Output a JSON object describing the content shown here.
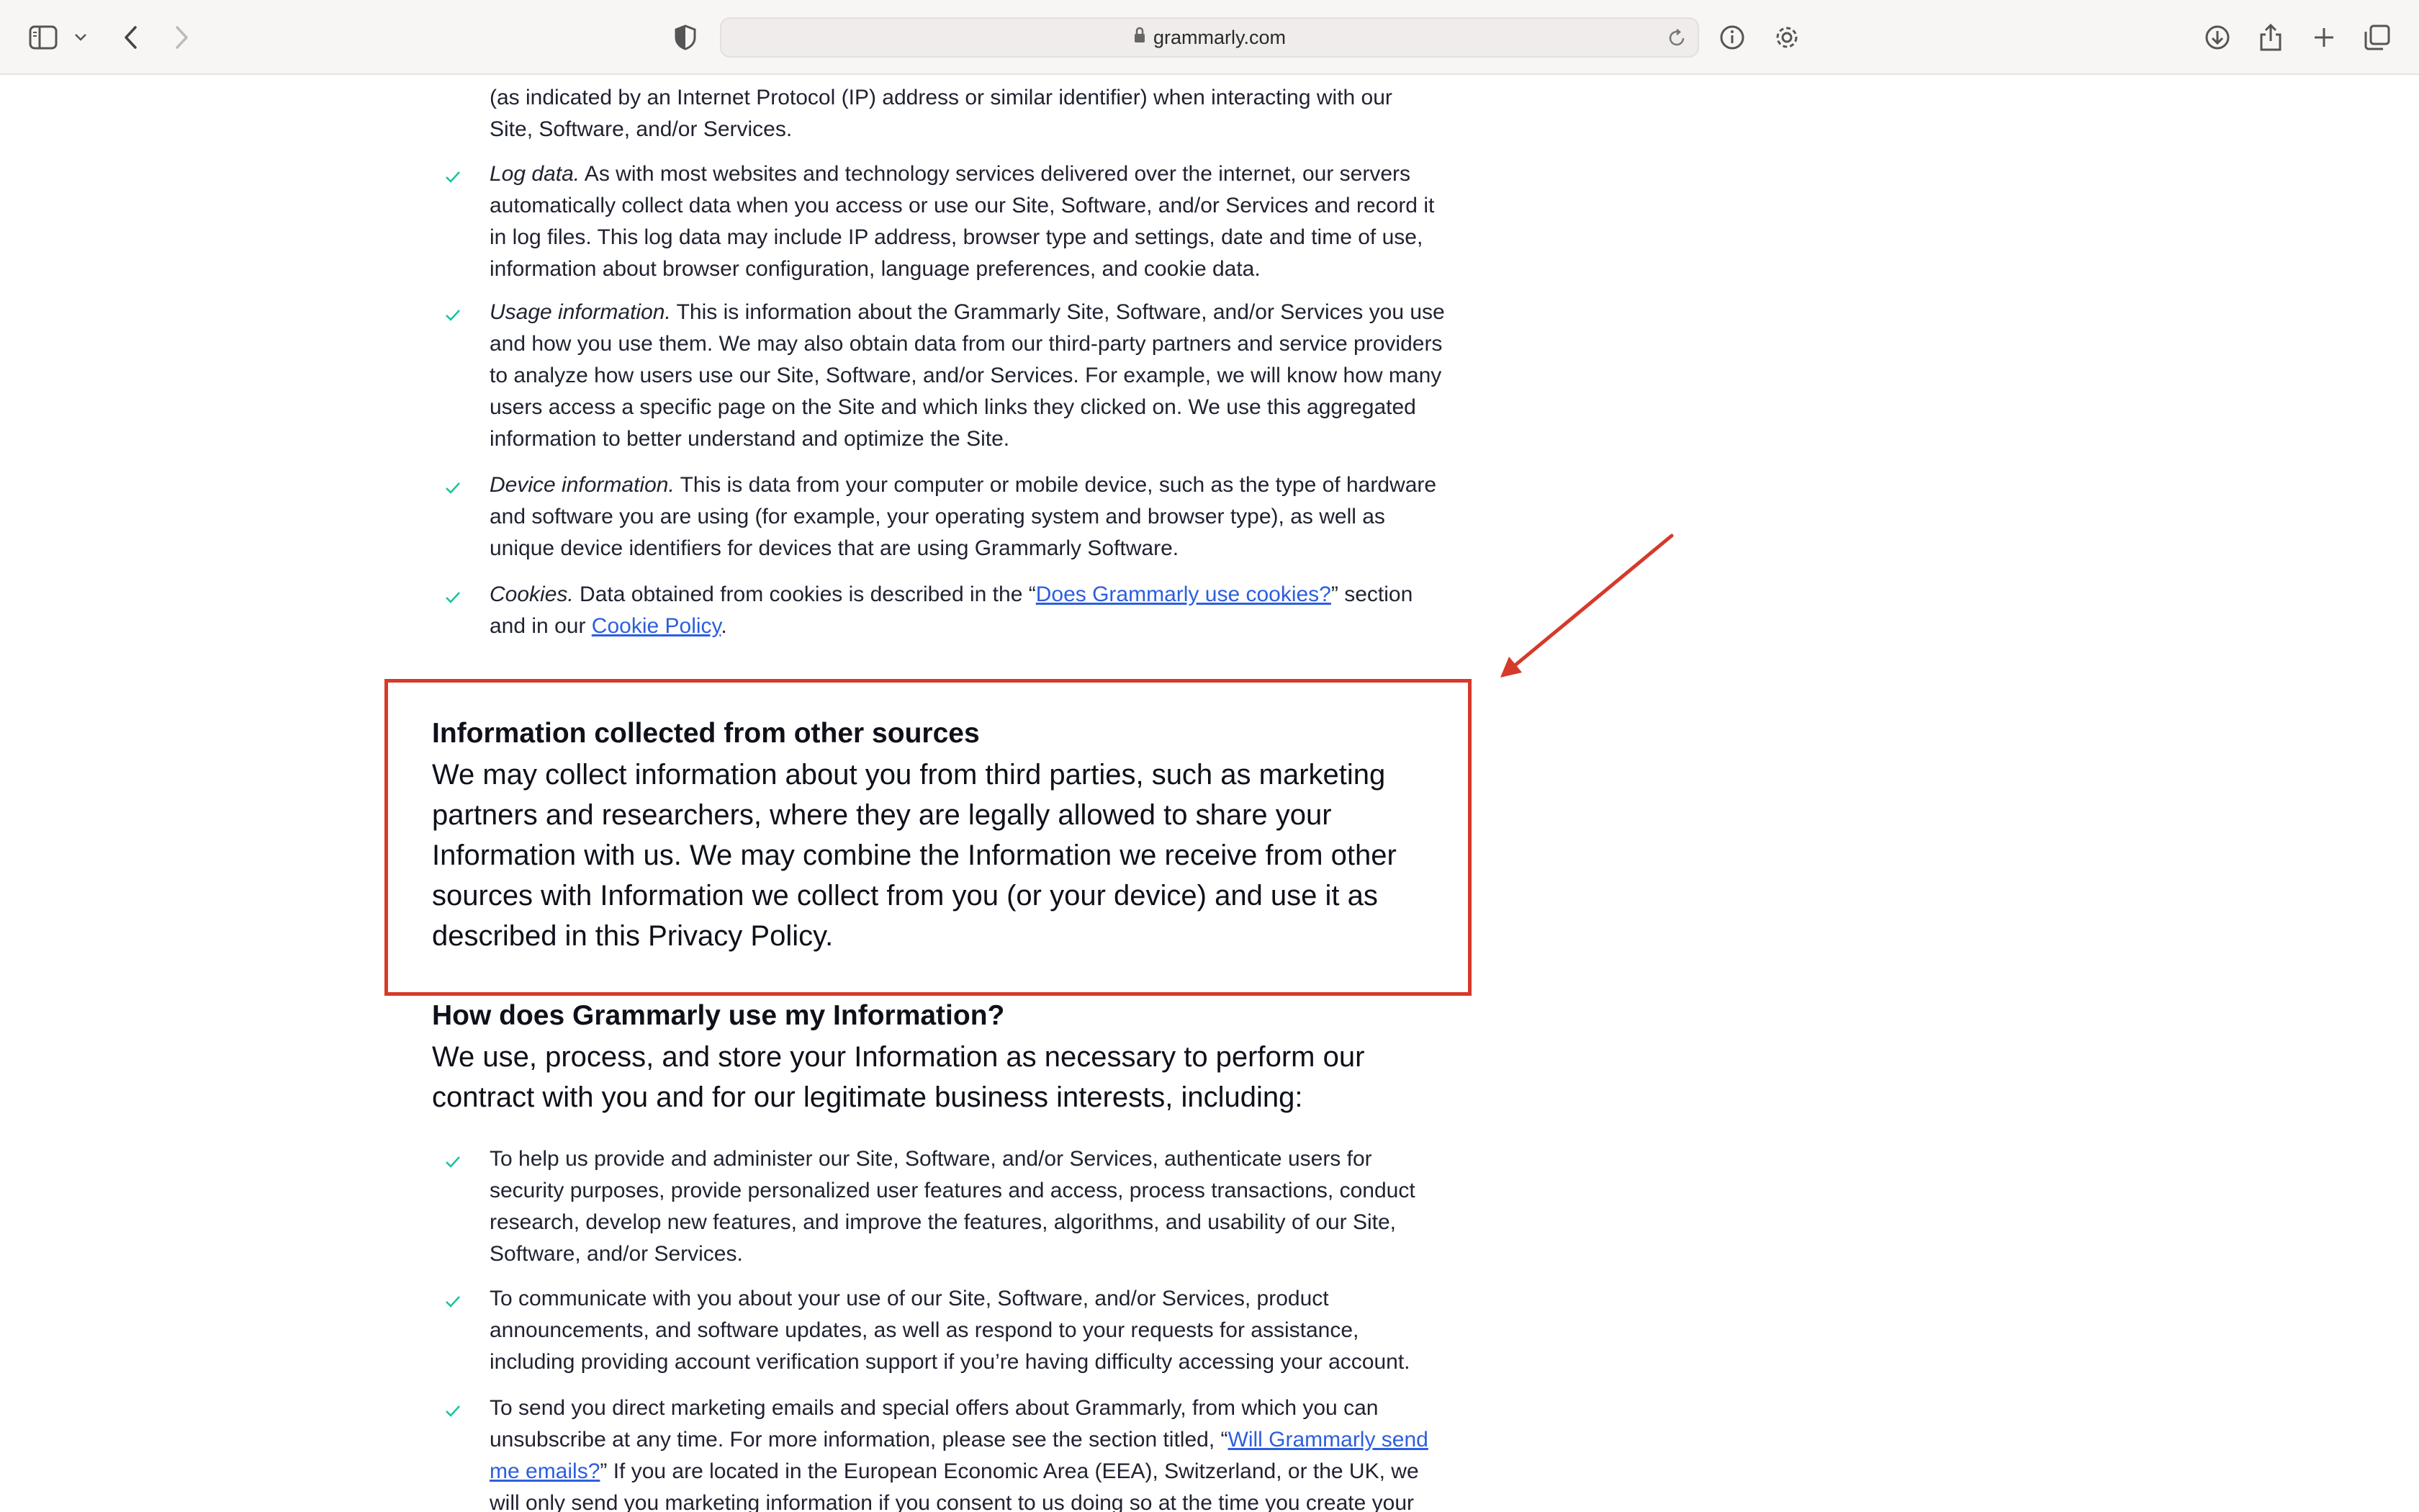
{
  "browser": {
    "url": "grammarly.com",
    "icons": [
      "sidebar-icon",
      "chevron-down-icon",
      "back-icon",
      "forward-icon",
      "shield-icon",
      "lock-icon",
      "reload-icon",
      "info-icon",
      "gear-icon",
      "download-icon",
      "share-icon",
      "plus-icon",
      "tabs-icon"
    ]
  },
  "content": {
    "top_fragment": {
      "line1": "(as indicated by an Internet Protocol (IP) address or similar identifier) when interacting with our",
      "line2": "Site, Software, and/or Services."
    },
    "items": [
      {
        "title": "Log data.",
        "text": " As with most websites and technology services delivered over the internet, our servers automatically collect data when you access or use our Site, Software, and/or Services and record it in log files. This log data may include IP address, browser type and settings, date and time of use, information about browser configuration, language preferences, and cookie data."
      },
      {
        "title": "Usage information.",
        "text": " This is information about the Grammarly Site, Software, and/or Services you use and how you use them. We may also obtain data from our third-party partners and service providers to analyze how users use our Site, Software, and/or Services. For example, we will know how many users access a specific page on the Site and which links they clicked on. We use this aggregated information to better understand and optimize the Site."
      },
      {
        "title": "Device information.",
        "text": " This is data from your computer or mobile device, such as the type of hardware and software you are using (for example, your operating system and browser type), as well as unique device identifiers for devices that are using Grammarly Software."
      },
      {
        "title": "Cookies.",
        "text_before": " Data obtained from cookies is described in the “",
        "link1": "Does Grammarly use cookies?",
        "text_mid": "” section and in our ",
        "link2": "Cookie Policy",
        "text_after": "."
      }
    ],
    "other_sources": {
      "heading": "Information collected from other sources",
      "body": "We may collect information about you from third parties, such as marketing partners and researchers, where they are legally allowed to share your Information with us. We may combine the Information we receive from other sources with Information we collect from you (or your device) and use it as described in this Privacy Policy."
    },
    "use_section": {
      "heading": "How does Grammarly use my Information?",
      "body": "We use, process, and store your Information as necessary to perform our contract with you and for our legitimate business interests, including:"
    },
    "use_items": [
      {
        "text": "To help us provide and administer our Site, Software, and/or Services, authenticate users for security purposes, provide personalized user features and access, process transactions, conduct research, develop new features, and improve the features, algorithms, and usability of our Site, Software, and/or Services."
      },
      {
        "text": "To communicate with you about your use of our Site, Software, and/or Services, product announcements, and software updates, as well as respond to your requests for assistance, including providing account verification support if you’re having difficulty accessing your account."
      },
      {
        "text_before": "To send you direct marketing emails and special offers about Grammarly, from which you can unsubscribe at any time. For more information, please see the section titled, “",
        "link": "Will Grammarly send me emails?",
        "text_after": "” If you are located in the European Economic Area (EEA), Switzerland, or the UK, we will only send you marketing information if you consent to us doing so at the time you create your"
      }
    ],
    "colors": {
      "link": "#2c5fde",
      "check": "#15c39a",
      "annotation": "#d53a2b"
    }
  }
}
